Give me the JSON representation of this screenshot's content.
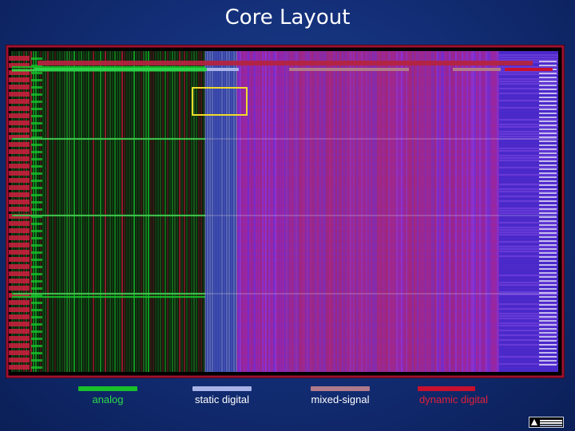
{
  "slide": {
    "title": "Core Layout"
  },
  "layout_image": {
    "icon": "chip-layout-diagram",
    "colors": {
      "background": "#000000",
      "analog": "#18c02a",
      "static_digital": "#a9b3e8",
      "mixed_signal": "#b07a8a",
      "dynamic_digital": "#c8102e",
      "dense_region": "#8a2ad6",
      "highlight_box": "#f2dc2a"
    }
  },
  "legend": [
    {
      "label": "analog",
      "color": "#18c02a",
      "text_color": "#2bd94a"
    },
    {
      "label": "static digital",
      "color": "#a9b3e8",
      "text_color": "#ffffff"
    },
    {
      "label": "mixed-signal",
      "color": "#b07a8a",
      "text_color": "#ffffff"
    },
    {
      "label": "dynamic digital",
      "color": "#c8102e",
      "text_color": "#e0203a"
    }
  ],
  "logo": {
    "icon": "brookhaven-logo"
  }
}
